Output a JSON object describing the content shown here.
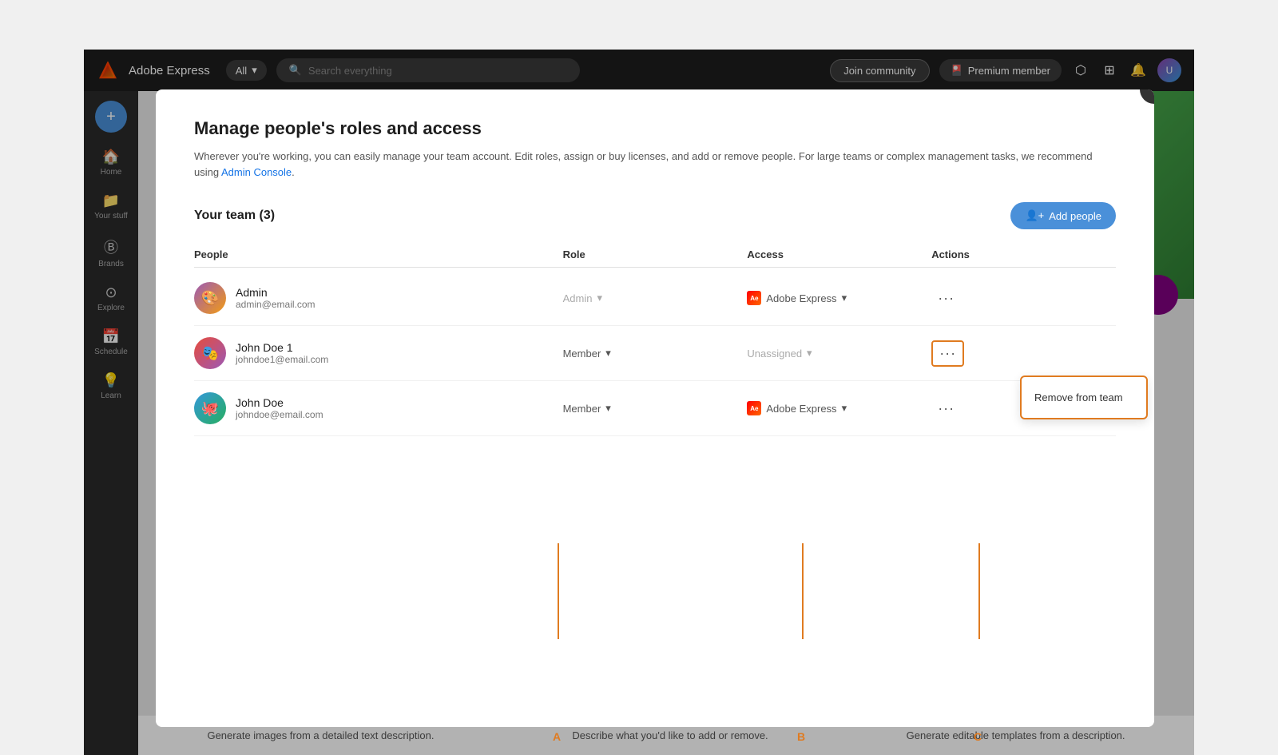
{
  "app": {
    "name": "Adobe Express",
    "search_placeholder": "Search everything",
    "join_community": "Join community",
    "premium_member": "Premium member"
  },
  "sidebar": {
    "items": [
      {
        "label": "Home",
        "icon": "🏠"
      },
      {
        "label": "Your stuff",
        "icon": "📁"
      },
      {
        "label": "Brands",
        "icon": "®"
      },
      {
        "label": "Explore",
        "icon": "🔍"
      },
      {
        "label": "Schedule",
        "icon": "📅"
      },
      {
        "label": "Learn",
        "icon": "💡"
      }
    ]
  },
  "modal": {
    "title": "Manage people's roles and access",
    "description": "Wherever you're working, you can easily manage your team account. Edit roles, assign or buy licenses, and add or remove people. For large teams or complex management tasks, we recommend using",
    "admin_console_link": "Admin Console",
    "team_title": "Your team (3)",
    "add_people_label": "Add people",
    "close_label": "×",
    "columns": {
      "people": "People",
      "role": "Role",
      "access": "Access",
      "actions": "Actions"
    },
    "members": [
      {
        "name": "Admin",
        "email": "admin@email.com",
        "role": "Admin",
        "role_muted": true,
        "access": "Adobe Express",
        "has_access_icon": true,
        "avatar_type": "admin"
      },
      {
        "name": "John Doe 1",
        "email": "johndoe1@email.com",
        "role": "Member",
        "role_muted": false,
        "access": "Unassigned",
        "has_access_icon": false,
        "avatar_type": "johndoe1",
        "dropdown_open": true
      },
      {
        "name": "John Doe",
        "email": "johndoe@email.com",
        "role": "Member",
        "role_muted": false,
        "access": "Adobe Express",
        "has_access_icon": true,
        "avatar_type": "johndoe"
      }
    ],
    "remove_from_team": "Remove from team"
  },
  "bottom_labels": [
    "Generate images from a detailed text description.",
    "Describe what you'd like to add or remove.",
    "Generate editable templates from a description."
  ],
  "annotations": {
    "a": "A",
    "b": "B",
    "c": "C"
  }
}
